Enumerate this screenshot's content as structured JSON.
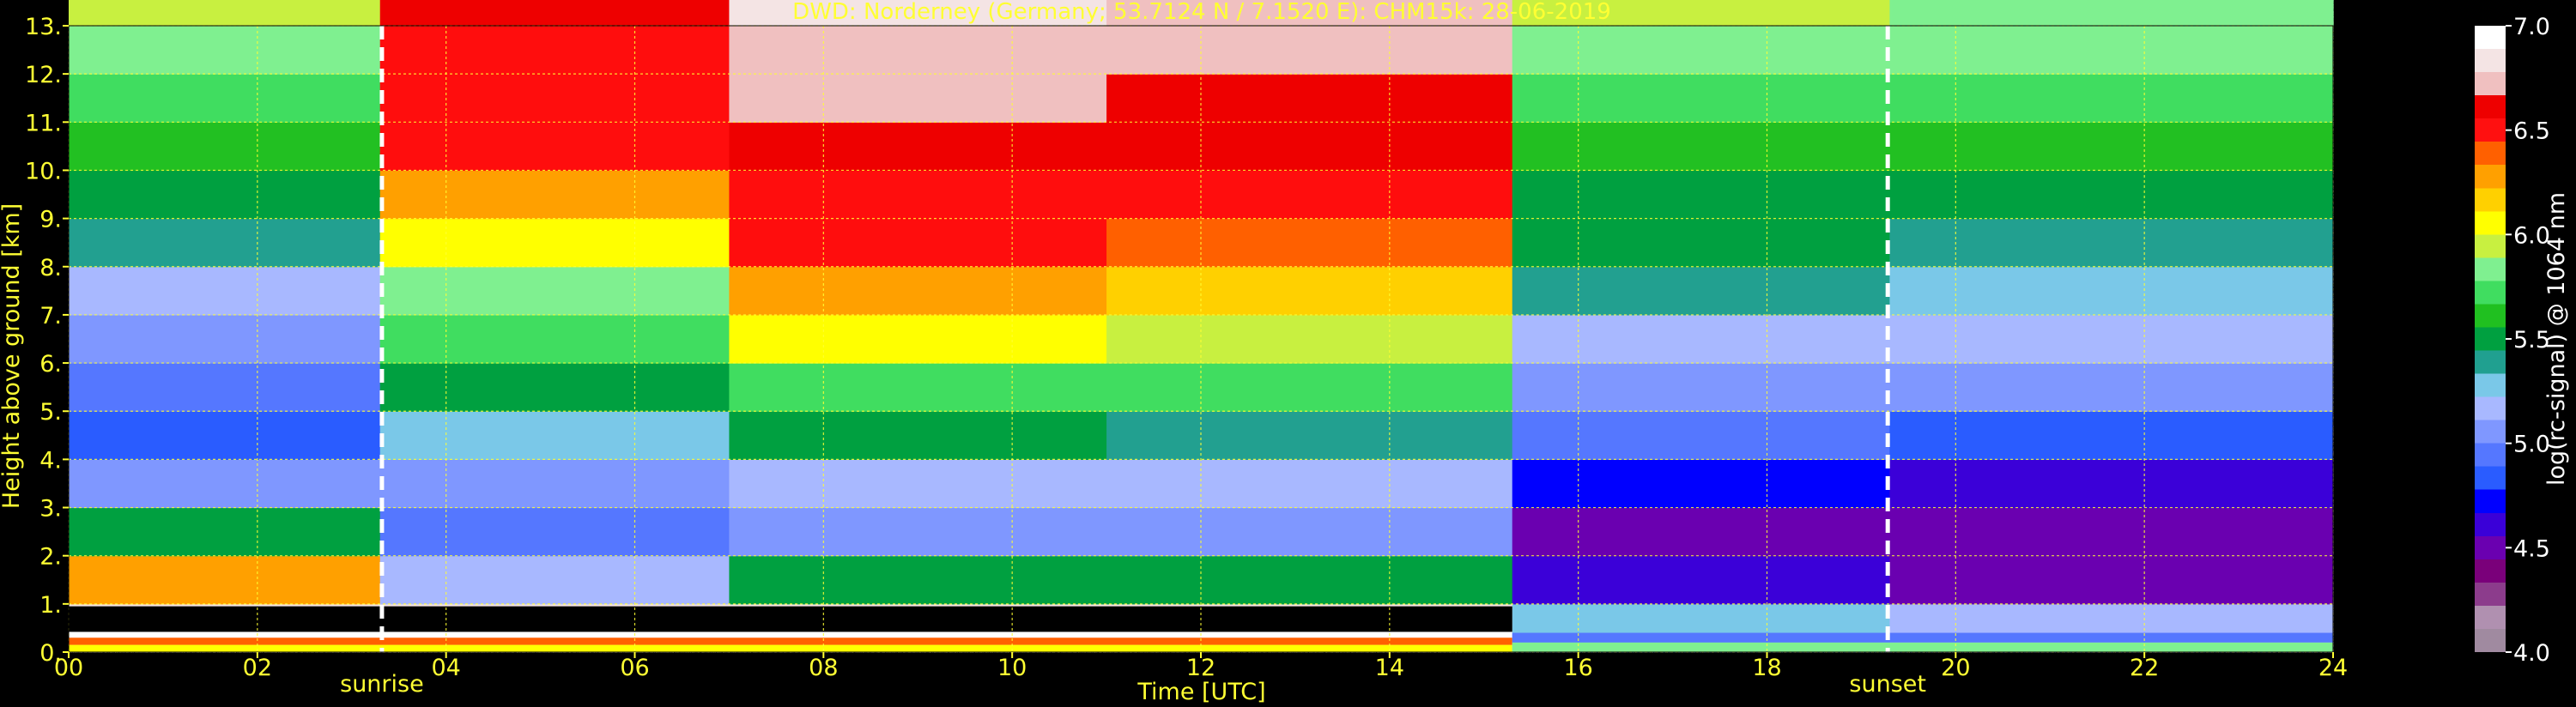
{
  "chart_data": {
    "type": "heatmap",
    "title": "DWD: Norderney (Germany; 53.7124 N / 7.1520 E):    CHM15k: 28-06-2019",
    "xlabel": "Time [UTC]",
    "ylabel": "Height above ground [km]",
    "colorbar_label": "log(rc-signal) @ 1064 nm",
    "xlim": [
      0,
      24
    ],
    "ylim": [
      0,
      13
    ],
    "x_ticks": [
      0,
      2,
      4,
      6,
      8,
      10,
      12,
      14,
      16,
      18,
      20,
      22,
      24
    ],
    "x_tick_labels": [
      "00",
      "02",
      "04",
      "06",
      "08",
      "10",
      "12",
      "14",
      "16",
      "18",
      "20",
      "22",
      "24"
    ],
    "y_ticks": [
      0,
      1,
      2,
      3,
      4,
      5,
      6,
      7,
      8,
      9,
      10,
      11,
      12,
      13
    ],
    "y_tick_labels": [
      "0.",
      "1.",
      "2.",
      "3.",
      "4.",
      "5.",
      "6.",
      "7.",
      "8.",
      "9.",
      "10.",
      "11.",
      "12.",
      "13."
    ],
    "colorbar_range": [
      4.0,
      7.0
    ],
    "colorbar_ticks": [
      4.0,
      4.5,
      5.0,
      5.5,
      6.0,
      6.5,
      7.0
    ],
    "colorbar_tick_labels": [
      "4.0",
      "4.5",
      "5.0",
      "5.5",
      "6.0",
      "6.5",
      "7.0"
    ],
    "colormap": [
      "#a08aa0",
      "#b090b0",
      "#8c3c8c",
      "#7a007a",
      "#6a00b0",
      "#3a00d8",
      "#0000ff",
      "#2a5cff",
      "#5577ff",
      "#7f97ff",
      "#a8b8ff",
      "#7ac8e8",
      "#20a090",
      "#00a040",
      "#20c020",
      "#40dd60",
      "#7ff090",
      "#c8f040",
      "#ffff00",
      "#ffd000",
      "#ffa000",
      "#ff6000",
      "#ff1010",
      "#ee0000",
      "#f0c0c0",
      "#f4e4e4",
      "#ffffff"
    ],
    "grid": true,
    "grid_color": "#ffff33",
    "annotations": [
      {
        "x": 3.32,
        "label": "sunrise"
      },
      {
        "x": 19.28,
        "label": "sunset"
      }
    ],
    "time_segments": [
      {
        "t0": 0.0,
        "t1": 3.3,
        "v": [
          6.8,
          6.3,
          5.45,
          5.0,
          4.8,
          4.95,
          5.05,
          5.2,
          5.35,
          5.5,
          5.65,
          5.75,
          5.85,
          5.9
        ]
      },
      {
        "t0": 3.3,
        "t1": 7.0,
        "v": [
          6.8,
          5.2,
          4.95,
          5.1,
          5.3,
          5.5,
          5.7,
          5.85,
          6.1,
          6.3,
          6.45,
          6.5,
          6.55,
          6.6
        ]
      },
      {
        "t0": 7.0,
        "t1": 11.0,
        "v": [
          6.8,
          5.45,
          5.1,
          5.2,
          5.45,
          5.75,
          6.0,
          6.25,
          6.45,
          6.55,
          6.65,
          6.7,
          6.75,
          6.8
        ]
      },
      {
        "t0": 11.0,
        "t1": 15.3,
        "v": [
          6.8,
          5.45,
          5.05,
          5.2,
          5.4,
          5.7,
          5.95,
          6.15,
          6.35,
          6.5,
          6.6,
          6.65,
          6.7,
          6.75
        ]
      },
      {
        "t0": 15.3,
        "t1": 19.3,
        "v": [
          5.3,
          4.6,
          4.5,
          4.7,
          4.9,
          5.05,
          5.2,
          5.35,
          5.45,
          5.55,
          5.65,
          5.75,
          5.85,
          5.9
        ]
      },
      {
        "t0": 19.3,
        "t1": 24.0,
        "v": [
          5.2,
          4.55,
          4.5,
          4.65,
          4.85,
          5.0,
          5.15,
          5.3,
          5.4,
          5.5,
          5.6,
          5.7,
          5.8,
          5.85
        ]
      }
    ]
  }
}
